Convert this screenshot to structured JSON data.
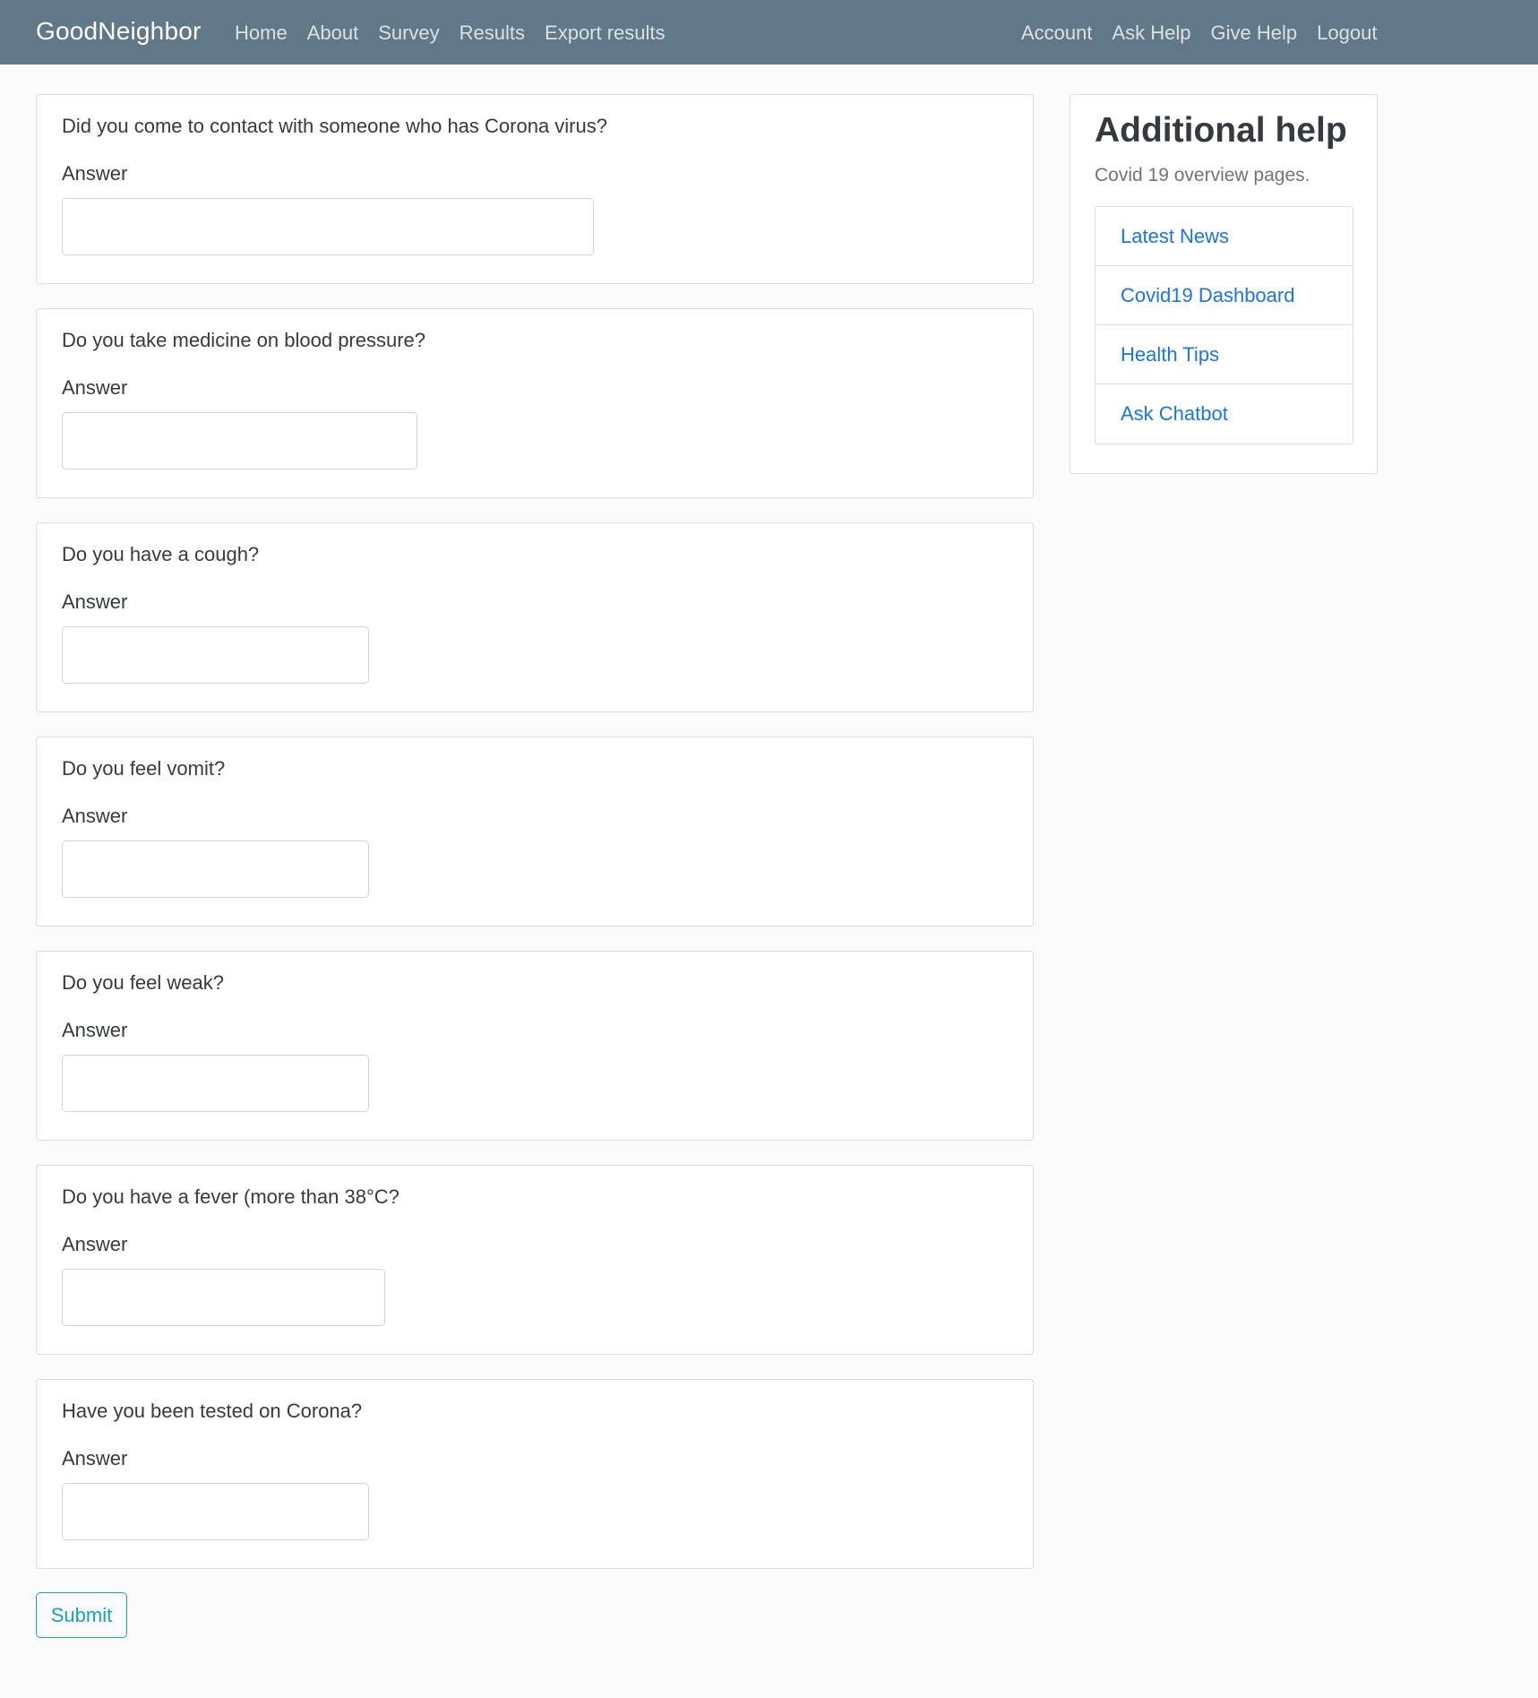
{
  "navbar": {
    "brand": "GoodNeighbor",
    "left_links": [
      "Home",
      "About",
      "Survey",
      "Results",
      "Export results"
    ],
    "right_links": [
      "Account",
      "Ask Help",
      "Give Help",
      "Logout"
    ]
  },
  "survey": {
    "answer_label": "Answer",
    "questions": [
      {
        "text": "Did you come to contact with someone who has Corona virus?",
        "value": ""
      },
      {
        "text": "Do you take medicine on blood pressure?",
        "value": ""
      },
      {
        "text": "Do you have a cough?",
        "value": ""
      },
      {
        "text": "Do you feel vomit?",
        "value": ""
      },
      {
        "text": "Do you feel weak?",
        "value": ""
      },
      {
        "text": "Do you have a fever (more than 38°C?",
        "value": ""
      },
      {
        "text": "Have you been tested on Corona?",
        "value": ""
      }
    ],
    "submit_label": "Submit"
  },
  "sidebar": {
    "title": "Additional help",
    "subtitle": "Covid 19 overview pages.",
    "links": [
      "Latest News",
      "Covid19 Dashboard",
      "Health Tips",
      "Ask Chatbot"
    ]
  },
  "colors": {
    "navbar_bg": "#607888",
    "link": "#1a73e8",
    "submit_outline": "#17a2b8",
    "page_bg": "#fafafa"
  }
}
